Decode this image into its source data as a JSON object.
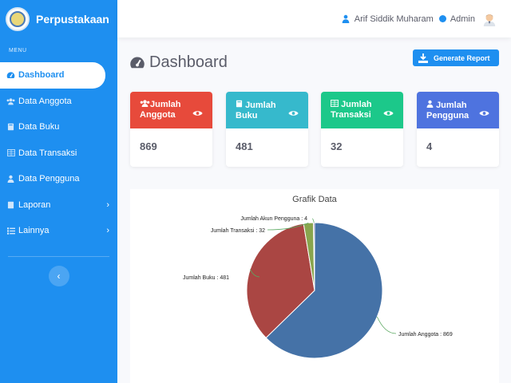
{
  "brand": {
    "title": "Perpustakaan"
  },
  "sidebar": {
    "menu_label": "MENU",
    "items": [
      {
        "label": "Dashboard",
        "icon": "tachometer-icon",
        "active": true
      },
      {
        "label": "Data Anggota",
        "icon": "users-icon"
      },
      {
        "label": "Data Buku",
        "icon": "book-icon"
      },
      {
        "label": "Data Transaksi",
        "icon": "table-icon"
      },
      {
        "label": "Data Pengguna",
        "icon": "user-icon"
      },
      {
        "label": "Laporan",
        "icon": "file-icon",
        "chevron": true
      },
      {
        "label": "Lainnya",
        "icon": "list-icon",
        "chevron": true
      }
    ]
  },
  "topbar": {
    "user_name": "Arif Siddik Muharam",
    "role": "Admin"
  },
  "page": {
    "title": "Dashboard",
    "generate_label": "Generate Report"
  },
  "cards": [
    {
      "title": "Jumlah Anggota",
      "value": "869",
      "color": "#e74a3b",
      "icon": "users-icon"
    },
    {
      "title": "Jumlah Buku",
      "value": "481",
      "color": "#36b9cc",
      "icon": "book-icon"
    },
    {
      "title": "Jumlah Transaksi",
      "value": "32",
      "color": "#1cc88a",
      "icon": "table-icon"
    },
    {
      "title": "Jumlah Pengguna",
      "value": "4",
      "color": "#4e73df",
      "icon": "user-icon"
    }
  ],
  "chart_data": {
    "type": "pie",
    "title": "Grafik Data",
    "slices": [
      {
        "label": "Jumlah Anggota",
        "value": 869,
        "color": "#4572a7"
      },
      {
        "label": "Jumlah Buku",
        "value": 481,
        "color": "#aa4643"
      },
      {
        "label": "Jumlah Transaksi",
        "value": 32,
        "color": "#89a54e"
      },
      {
        "label": "Jumlah Akun Pengguna",
        "value": 4,
        "color": "#80699b"
      }
    ],
    "data_labels": [
      "Jumlah Anggota : 869",
      "Jumlah Buku : 481",
      "Jumlah Transaksi : 32",
      "Jumlah Akun Pengguna : 4"
    ]
  }
}
